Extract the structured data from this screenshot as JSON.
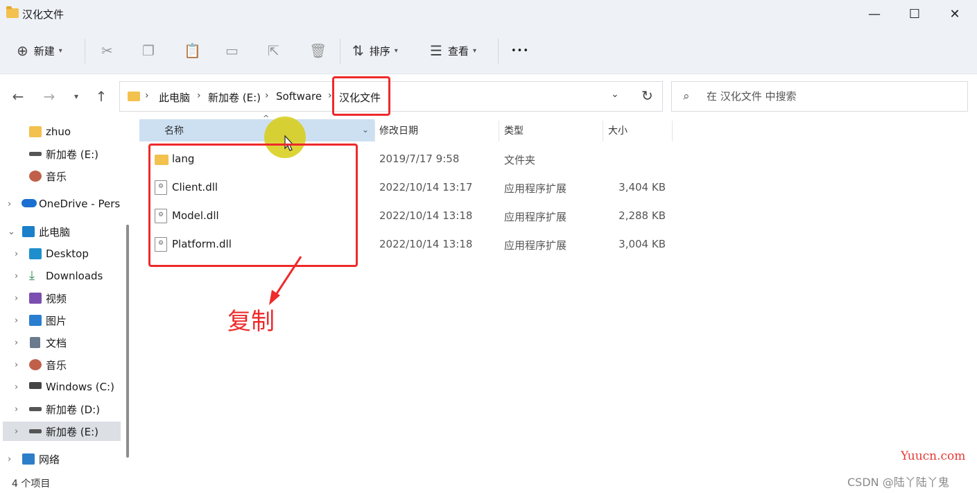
{
  "window": {
    "title": "汉化文件",
    "minimize_glyph": "—",
    "maximize_glyph": "☐",
    "close_glyph": "✕"
  },
  "commands": {
    "new_label": "新建",
    "sort_label": "排序",
    "view_label": "查看",
    "more_glyph": "•••",
    "icons": [
      "cut-icon",
      "copy-icon",
      "paste-icon",
      "rename-icon",
      "share-icon",
      "delete-icon"
    ]
  },
  "address": {
    "crumbs": [
      "此电脑",
      "新加卷 (E:)",
      "Software",
      "汉化文件"
    ],
    "separator": "›"
  },
  "search": {
    "placeholder": "在 汉化文件 中搜索"
  },
  "sidebar": {
    "items": [
      {
        "label": "zhuo",
        "icon": "folder-icon",
        "color": "#f2c14e"
      },
      {
        "label": "新加卷 (E:)",
        "icon": "drive-icon",
        "color": "#555555"
      },
      {
        "label": "音乐",
        "icon": "music-icon",
        "color": "#c0604a"
      },
      {
        "label": "OneDrive - Personal",
        "icon": "onedrive-icon",
        "color": "#1b6fd1"
      },
      {
        "label": "此电脑",
        "icon": "computer-icon",
        "color": "#1b7fc9"
      },
      {
        "label": "Desktop",
        "icon": "desktop-icon",
        "color": "#1e8fcc"
      },
      {
        "label": "Downloads",
        "icon": "download-icon",
        "color": "#2f8a55"
      },
      {
        "label": "视频",
        "icon": "video-icon",
        "color": "#7a4fb0"
      },
      {
        "label": "图片",
        "icon": "picture-icon",
        "color": "#2a7ed0"
      },
      {
        "label": "文档",
        "icon": "document-icon",
        "color": "#6b7b8e"
      },
      {
        "label": "音乐",
        "icon": "music-icon",
        "color": "#c0604a"
      },
      {
        "label": "Windows (C:)",
        "icon": "drive-icon",
        "color": "#444444"
      },
      {
        "label": "新加卷 (D:)",
        "icon": "drive-icon",
        "color": "#555555"
      },
      {
        "label": "新加卷 (E:)",
        "icon": "drive-icon",
        "color": "#555555"
      },
      {
        "label": "网络",
        "icon": "network-icon",
        "color": "#2c7ec8"
      }
    ]
  },
  "columns": {
    "name": "名称",
    "modified": "修改日期",
    "type": "类型",
    "size": "大小"
  },
  "files": [
    {
      "name": "lang",
      "modified": "2019/7/17 9:58",
      "type": "文件夹",
      "size": ""
    },
    {
      "name": "Client.dll",
      "modified": "2022/10/14 13:17",
      "type": "应用程序扩展",
      "size": "3,404 KB"
    },
    {
      "name": "Model.dll",
      "modified": "2022/10/14 13:18",
      "type": "应用程序扩展",
      "size": "2,288 KB"
    },
    {
      "name": "Platform.dll",
      "modified": "2022/10/14 13:18",
      "type": "应用程序扩展",
      "size": "3,004 KB"
    }
  ],
  "annotation": {
    "text": "复制",
    "color": "#ee2a2a"
  },
  "status": {
    "count": "4 个项目"
  },
  "watermark": {
    "site": "Yuucn.com",
    "author": "CSDN @陆丫陆丫鬼"
  }
}
